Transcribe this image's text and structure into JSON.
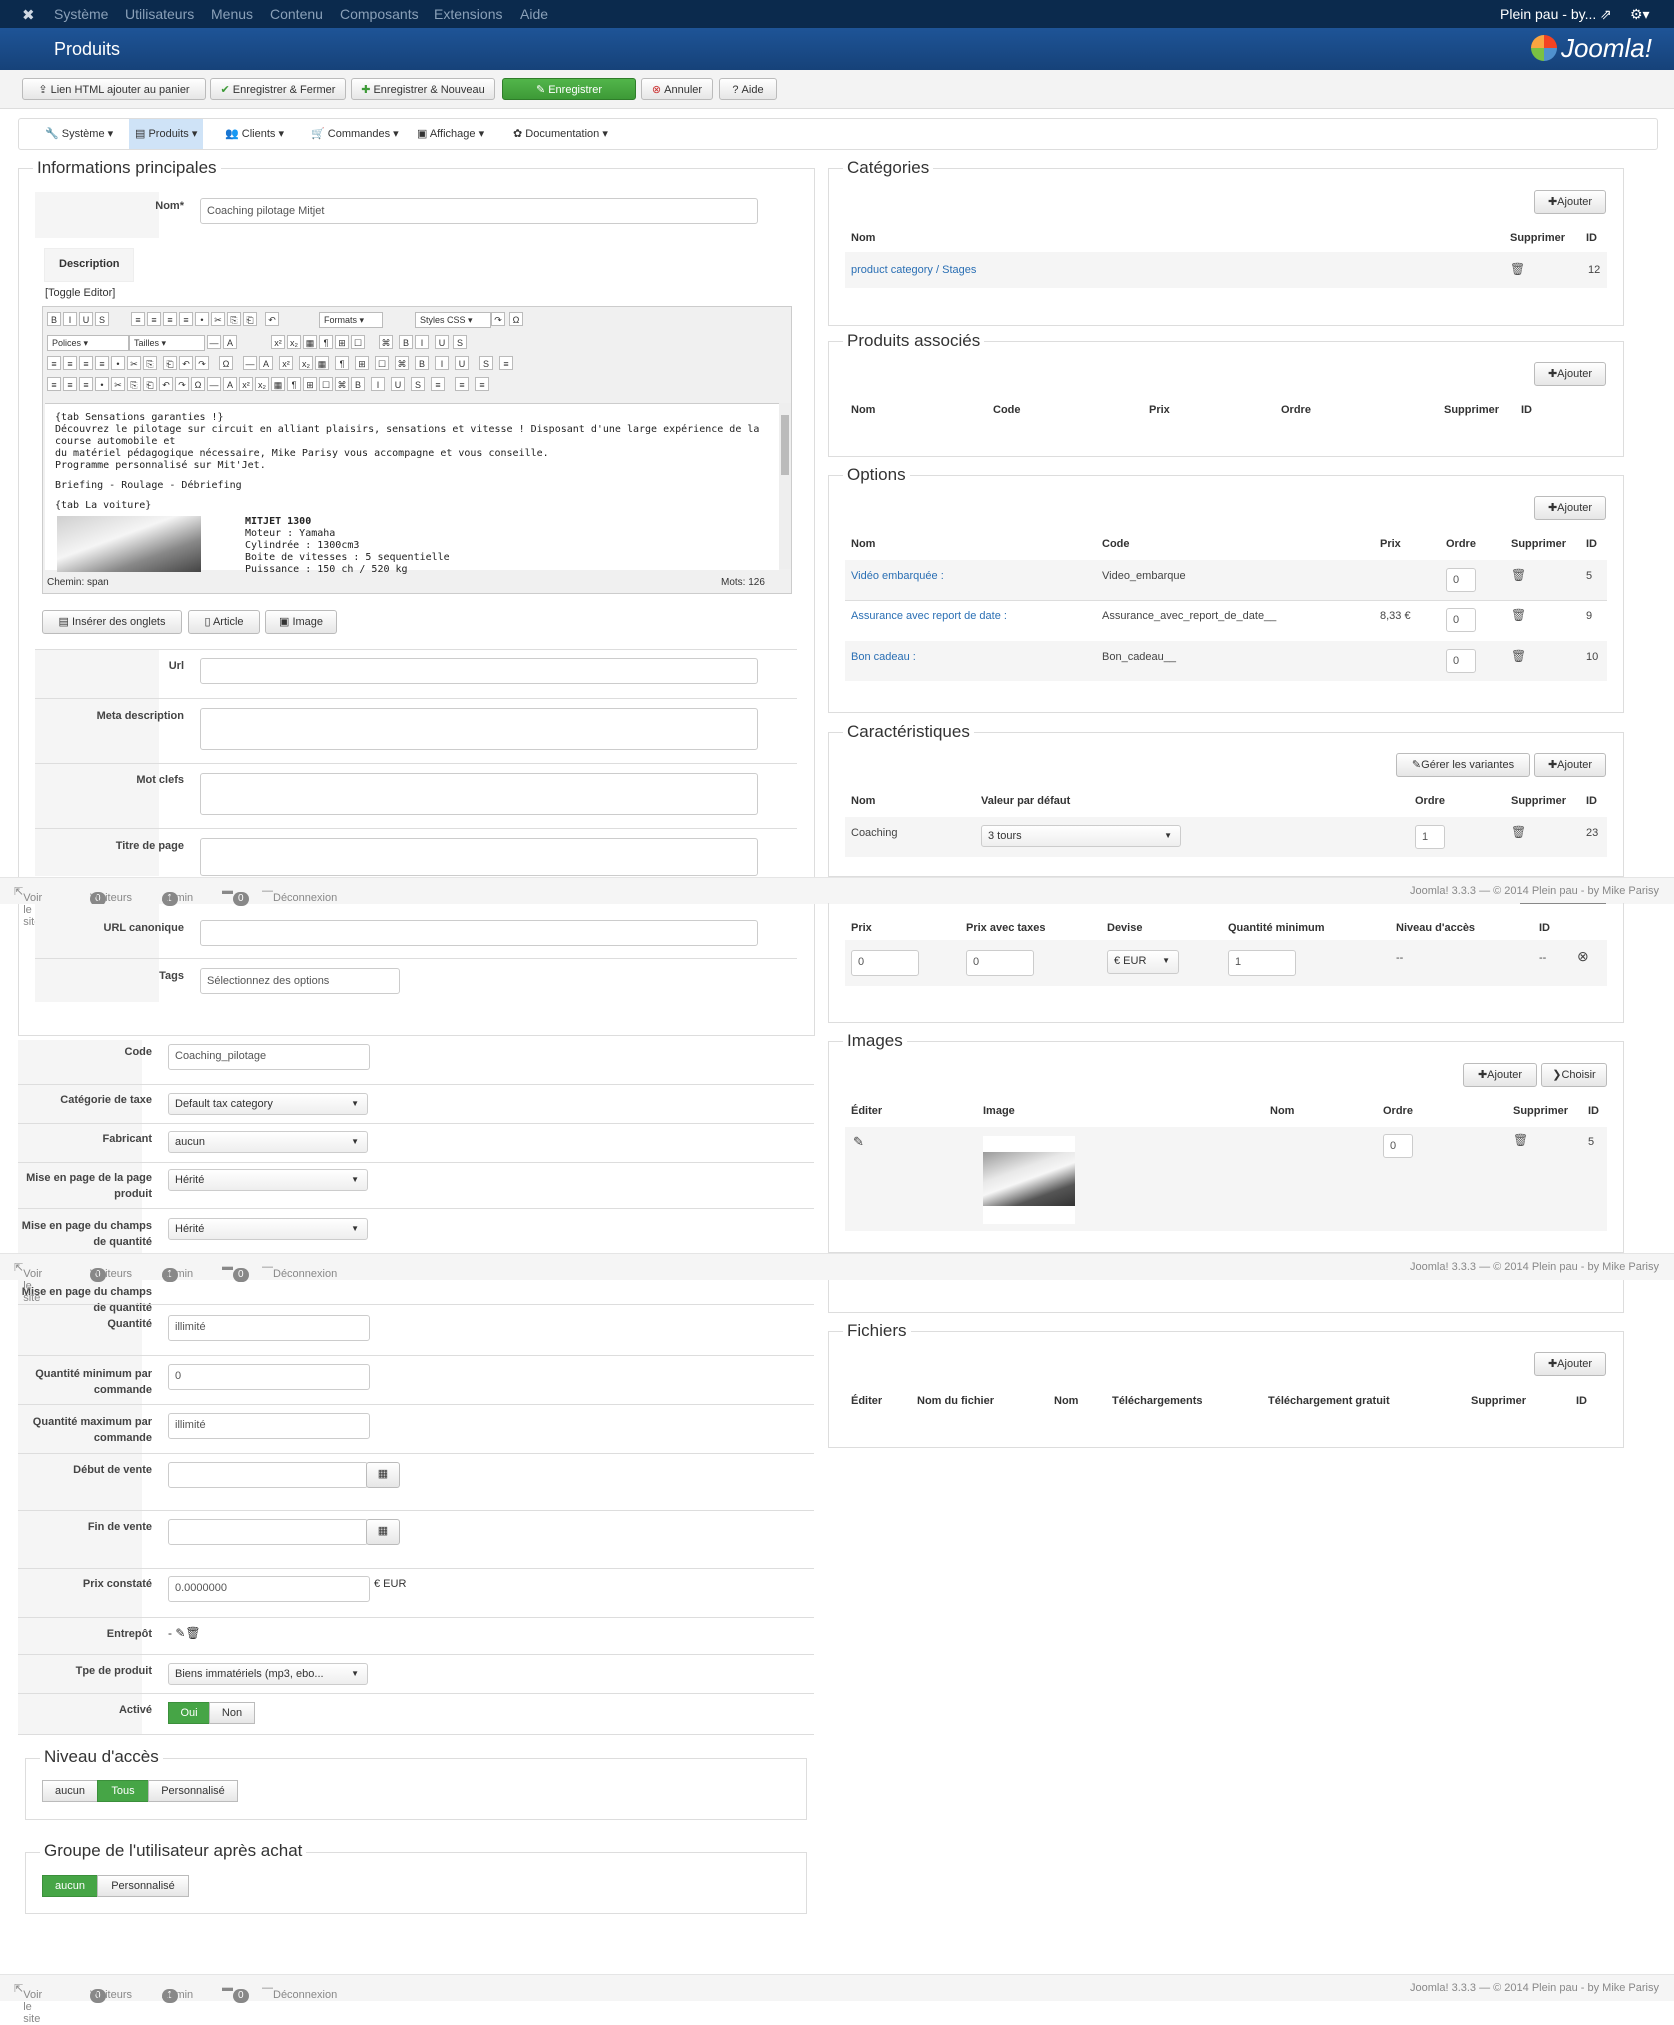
{
  "topnav": {
    "items": [
      "Système",
      "Utilisateurs",
      "Menus",
      "Contenu",
      "Composants",
      "Extensions",
      "Aide"
    ],
    "user": "Plein pau - by..."
  },
  "header": {
    "title": "Produits",
    "logo": "Joomla!"
  },
  "toolbar": {
    "link_html": "Lien HTML ajouter au panier",
    "save_close": "Enregistrer & Fermer",
    "save_new": "Enregistrer & Nouveau",
    "save": "Enregistrer",
    "cancel": "Annuler",
    "help": "Aide"
  },
  "submenu": [
    "Système",
    "Produits",
    "Clients",
    "Commandes",
    "Affichage",
    "Documentation"
  ],
  "main_info": {
    "legend": "Informations principales",
    "name_label": "Nom*",
    "name_value": "Coaching pilotage Mitjet",
    "description_tab": "Description",
    "toggle_editor": "[Toggle Editor]",
    "formats": "Formats",
    "styles": "Styles CSS",
    "fonts": "Polices",
    "sizes": "Tailles",
    "content_lines": [
      "{tab Sensations garanties !}",
      "Découvrez le pilotage sur circuit en alliant plaisirs, sensations et vitesse ! Disposant d'une large expérience de la course automobile et",
      "du matériel pédagogique nécessaire, Mike Parisy vous accompagne et vous conseille.",
      "Programme personnalisé sur Mit'Jet.",
      "Briefing - Roulage - Débriefing",
      "{tab La voiture}"
    ],
    "car_lines": [
      "MITJET 1300",
      "Moteur : Yamaha",
      "Cylindrée : 1300cm3",
      "Boite de vitesses : 5 sequentielle",
      "Puissance : 150 ch / 520 kg"
    ],
    "path": "Chemin: span",
    "words": "Mots: 126",
    "insert_tabs": "Insérer des onglets",
    "article": "Article",
    "image": "Image",
    "url_label": "Url",
    "meta_desc_label": "Meta description",
    "keywords_label": "Mot clefs",
    "page_title_label": "Titre de page",
    "canonical_label": "URL canonique",
    "tags_label": "Tags",
    "tags_placeholder": "Sélectionnez des options"
  },
  "left_fields": {
    "code_label": "Code",
    "code_value": "Coaching_pilotage",
    "tax_label": "Catégorie de taxe",
    "tax_value": "Default tax category",
    "maker_label": "Fabricant",
    "maker_value": "aucun",
    "layout_label": "Mise en page de la page produit",
    "layout_value": "Hérité",
    "qty_layout_label": "Mise en page du champs de quantité",
    "qty_layout_value": "Hérité",
    "qty_label": "Quantité",
    "qty_value": "illimité",
    "min_qty_label": "Quantité minimum par commande",
    "min_qty_value": "0",
    "max_qty_label": "Quantité maximum par commande",
    "max_qty_value": "illimité",
    "start_label": "Début de vente",
    "end_label": "Fin de vente",
    "price_label": "Prix constaté",
    "price_value": "0.0000000",
    "price_currency": "€ EUR",
    "warehouse_label": "Entrepôt",
    "warehouse_value": "-",
    "type_label": "Tpe de produit",
    "type_value": "Biens immatériels (mp3, ebo...",
    "active_label": "Activé",
    "active_yes": "Oui",
    "active_no": "Non"
  },
  "access": {
    "legend": "Niveau d'accès",
    "options": [
      "aucun",
      "Tous",
      "Personnalisé"
    ]
  },
  "group": {
    "legend": "Groupe de l'utilisateur après achat",
    "options": [
      "aucun",
      "Personnalisé"
    ]
  },
  "categories": {
    "legend": "Catégories",
    "add": "Ajouter",
    "headers": [
      "Nom",
      "Supprimer",
      "ID"
    ],
    "rows": [
      {
        "name": "product category / Stages",
        "id": "12"
      }
    ]
  },
  "related": {
    "legend": "Produits associés",
    "add": "Ajouter",
    "headers": [
      "Nom",
      "Code",
      "Prix",
      "Ordre",
      "Supprimer",
      "ID"
    ]
  },
  "options": {
    "legend": "Options",
    "add": "Ajouter",
    "headers": [
      "Nom",
      "Code",
      "Prix",
      "Ordre",
      "Supprimer",
      "ID"
    ],
    "rows": [
      {
        "name": "Vidéo embarquée :",
        "code": "Video_embarque",
        "price": "",
        "order": "0",
        "id": "5"
      },
      {
        "name": "Assurance avec report de date :",
        "code": "Assurance_avec_report_de_date__",
        "price": "8,33 €",
        "order": "0",
        "id": "9"
      },
      {
        "name": "Bon cadeau :",
        "code": "Bon_cadeau__",
        "price": "",
        "order": "0",
        "id": "10"
      }
    ]
  },
  "characteristics": {
    "legend": "Caractéristiques",
    "manage": "Gérer les variantes",
    "add": "Ajouter",
    "headers": [
      "Nom",
      "Valeur par défaut",
      "Ordre",
      "Supprimer",
      "ID"
    ],
    "rows": [
      {
        "name": "Coaching",
        "value": "3 tours",
        "order": "1",
        "id": "23"
      }
    ]
  },
  "prices": {
    "headers": [
      "Prix",
      "Prix avec taxes",
      "Devise",
      "Quantité minimum",
      "Niveau d'accès",
      "ID"
    ],
    "row": {
      "price": "0",
      "price_tax": "0",
      "currency": "€ EUR",
      "min_qty": "1",
      "access": "--",
      "id": "--"
    }
  },
  "images": {
    "legend": "Images",
    "add": "Ajouter",
    "choose": "Choisir",
    "headers": [
      "Éditer",
      "Image",
      "Nom",
      "Ordre",
      "Supprimer",
      "ID"
    ],
    "row": {
      "order": "0",
      "id": "5"
    }
  },
  "files": {
    "legend": "Fichiers",
    "add": "Ajouter",
    "headers": [
      "Éditer",
      "Nom du fichier",
      "Nom",
      "Téléchargements",
      "Téléchargement gratuit",
      "Supprimer",
      "ID"
    ]
  },
  "statusbar": {
    "view_site": "Voir le site",
    "visitors_count": "0",
    "visitors": "Visiteurs",
    "admin_count": "1",
    "admin": "Admin",
    "msg_count": "0",
    "logout": "Déconnexion",
    "version": "Joomla! 3.3.3 — © 2014 Plein pau - by Mike Parisy"
  },
  "colors": {
    "navbar": "#0b2a4d",
    "header": "#1a4a8a",
    "save": "#46a546",
    "link": "#2a6fb4"
  }
}
